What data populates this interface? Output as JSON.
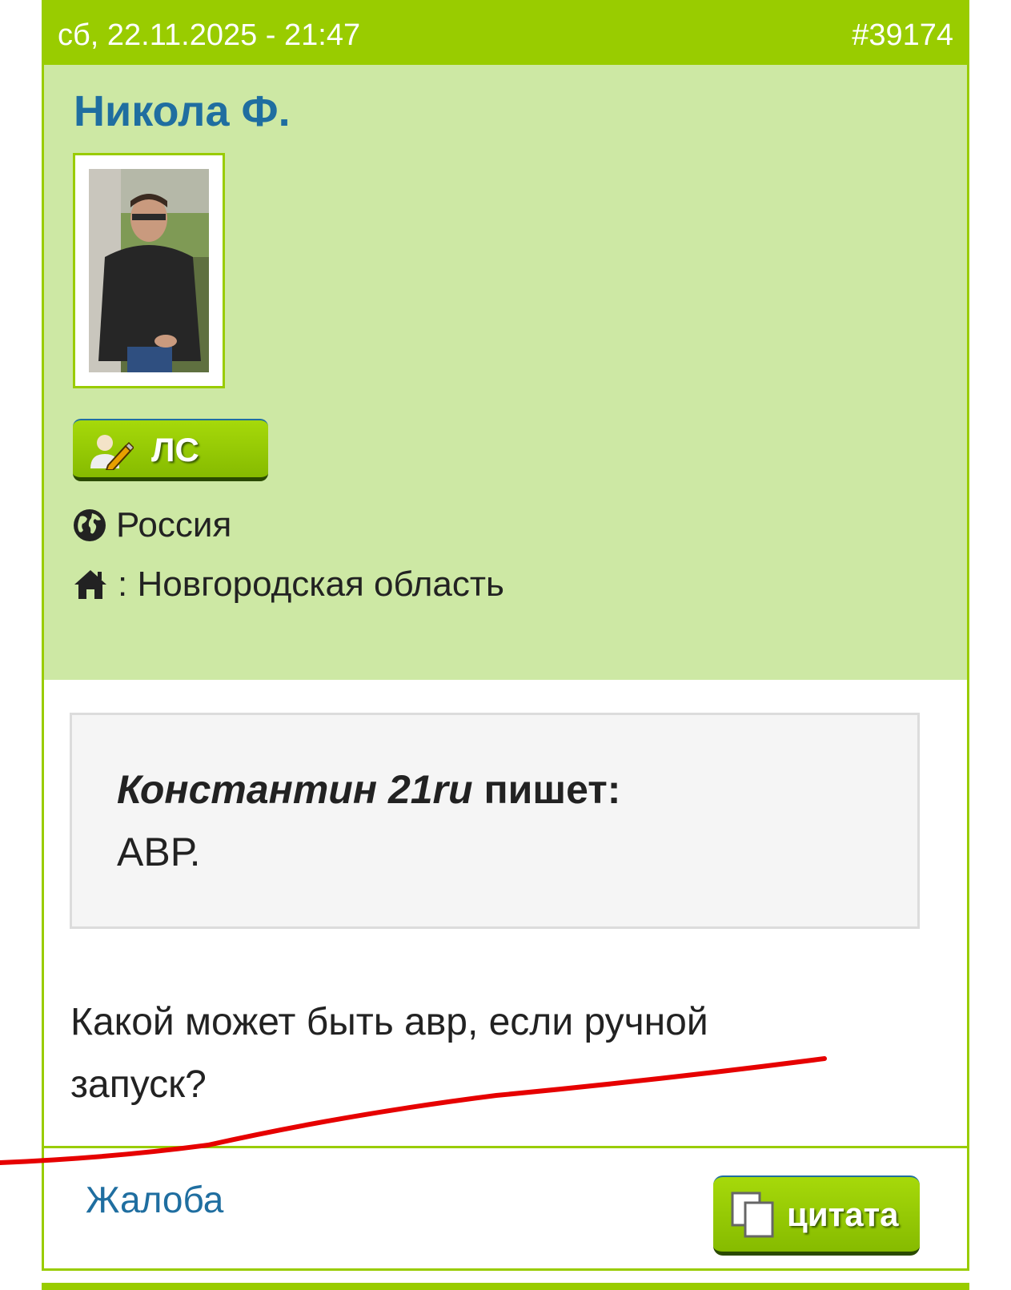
{
  "post": {
    "date": "сб, 22.11.2025 - 21:47",
    "number": "#39174"
  },
  "author": {
    "name": "Никола Ф.",
    "pm_label": "ЛС",
    "country": "Россия",
    "region": ": Новгородская область"
  },
  "quote": {
    "author": "Константин 21ru",
    "writes": " пишет:",
    "text": "АВР."
  },
  "body": {
    "text": "Какой может быть авр, если ручной запуск?"
  },
  "footer": {
    "complaint": "Жалоба",
    "quote_button": "цитата"
  },
  "colors": {
    "accent": "#99cc00",
    "panel": "#cde8a4",
    "link": "#1f6ea0",
    "annotation": "#e60000"
  },
  "icons": [
    "globe-icon",
    "home-icon",
    "pm-user-edit-icon",
    "copy-icon"
  ]
}
